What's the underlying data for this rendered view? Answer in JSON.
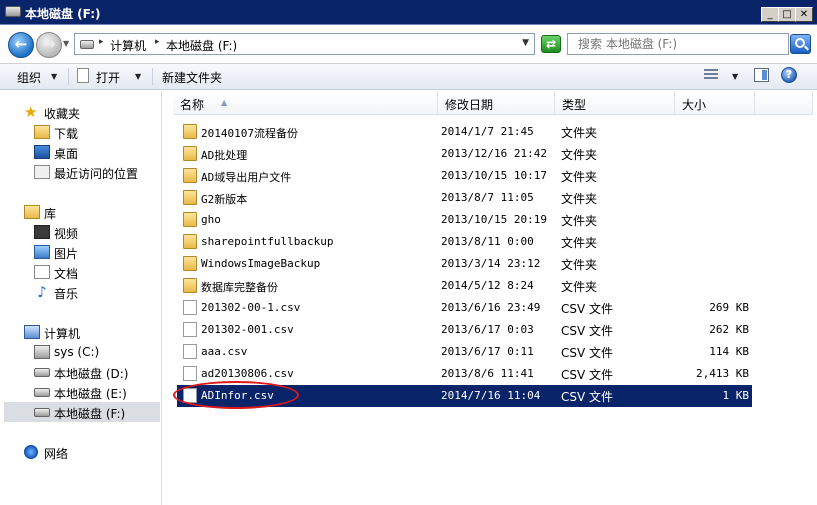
{
  "window": {
    "title": "本地磁盘 (F:)"
  },
  "address": {
    "crumbs": [
      "计算机",
      "本地磁盘 (F:)"
    ],
    "search_placeholder": "搜索 本地磁盘 (F:)"
  },
  "toolbar": {
    "organize": "组织",
    "open": "打开",
    "new_folder": "新建文件夹"
  },
  "nav": {
    "favorites": "收藏夹",
    "downloads": "下载",
    "desktop": "桌面",
    "recent": "最近访问的位置",
    "libraries": "库",
    "videos": "视频",
    "pictures": "图片",
    "documents": "文档",
    "music": "音乐",
    "computer": "计算机",
    "drive_c": "sys (C:)",
    "drive_d": "本地磁盘 (D:)",
    "drive_e": "本地磁盘 (E:)",
    "drive_f": "本地磁盘 (F:)",
    "network": "网络"
  },
  "columns": {
    "name": "名称",
    "modified": "修改日期",
    "type": "类型",
    "size": "大小"
  },
  "files": [
    {
      "name": "20140107流程备份",
      "date": "2014/1/7 21:45",
      "type": "文件夹",
      "size": "",
      "kind": "folder"
    },
    {
      "name": "AD批处理",
      "date": "2013/12/16 21:42",
      "type": "文件夹",
      "size": "",
      "kind": "folder"
    },
    {
      "name": "AD域导出用户文件",
      "date": "2013/10/15 10:17",
      "type": "文件夹",
      "size": "",
      "kind": "folder"
    },
    {
      "name": "G2新版本",
      "date": "2013/8/7 11:05",
      "type": "文件夹",
      "size": "",
      "kind": "folder"
    },
    {
      "name": "gho",
      "date": "2013/10/15 20:19",
      "type": "文件夹",
      "size": "",
      "kind": "folder"
    },
    {
      "name": "sharepointfullbackup",
      "date": "2013/8/11 0:00",
      "type": "文件夹",
      "size": "",
      "kind": "folder"
    },
    {
      "name": "WindowsImageBackup",
      "date": "2013/3/14 23:12",
      "type": "文件夹",
      "size": "",
      "kind": "folder"
    },
    {
      "name": "数据库完整备份",
      "date": "2014/5/12 8:24",
      "type": "文件夹",
      "size": "",
      "kind": "folder"
    },
    {
      "name": "201302-00-1.csv",
      "date": "2013/6/16 23:49",
      "type": "CSV 文件",
      "size": "269 KB",
      "kind": "file"
    },
    {
      "name": "201302-001.csv",
      "date": "2013/6/17 0:03",
      "type": "CSV 文件",
      "size": "262 KB",
      "kind": "file"
    },
    {
      "name": "aaa.csv",
      "date": "2013/6/17 0:11",
      "type": "CSV 文件",
      "size": "114 KB",
      "kind": "file"
    },
    {
      "name": "ad20130806.csv",
      "date": "2013/8/6 11:41",
      "type": "CSV 文件",
      "size": "2,413 KB",
      "kind": "file"
    },
    {
      "name": "ADInfor.csv",
      "date": "2014/7/16 11:04",
      "type": "CSV 文件",
      "size": "1 KB",
      "kind": "file",
      "selected": true
    }
  ]
}
